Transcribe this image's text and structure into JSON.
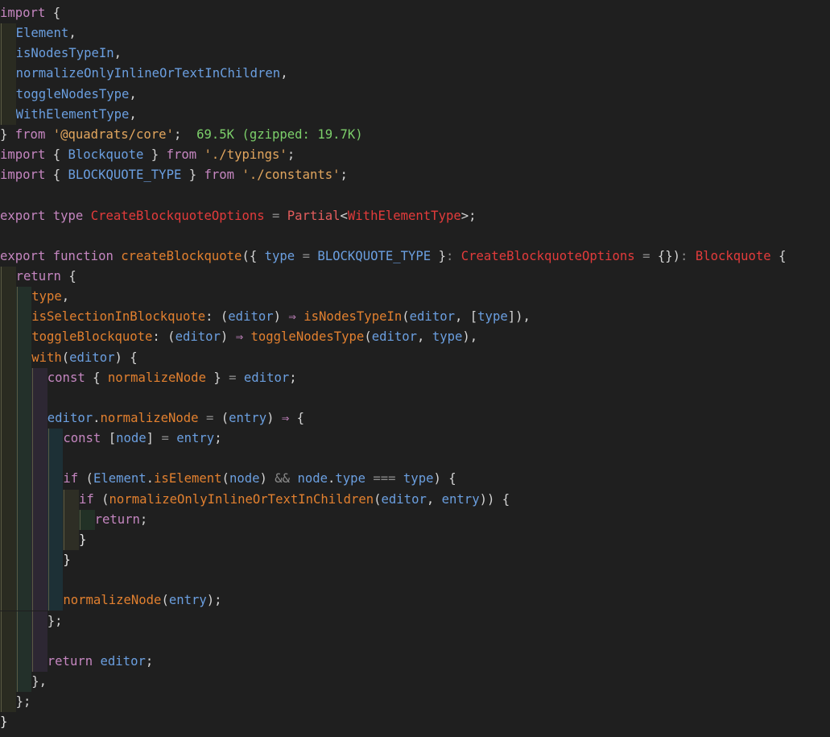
{
  "file": {
    "import_cost": "69.5K (gzipped: 19.7K)"
  },
  "code": {
    "import_kw": "import",
    "export_kw": "export",
    "from_kw": "from",
    "type_kw": "type",
    "function_kw": "function",
    "return_kw": "return",
    "with_kw": "with",
    "const_kw": "const",
    "if_kw": "if",
    "element": "Element",
    "isNodesTypeIn": "isNodesTypeIn",
    "normalizeOnlyInlineOrTextInChildren": "normalizeOnlyInlineOrTextInChildren",
    "toggleNodesType": "toggleNodesType",
    "withElementType": "WithElementType",
    "core_path": "'@quadrats/core'",
    "blockquote": "Blockquote",
    "typings_path": "'./typings'",
    "BLOCKQUOTE_TYPE": "BLOCKQUOTE_TYPE",
    "constants_path": "'./constants'",
    "createBlockquoteOptions": "CreateBlockquoteOptions",
    "partial": "Partial",
    "createBlockquote": "createBlockquote",
    "type_param": "type",
    "isSelectionInBlockquote": "isSelectionInBlockquote",
    "toggleBlockquote": "toggleBlockquote",
    "editor": "editor",
    "normalizeNode": "normalizeNode",
    "entry": "entry",
    "node": "node",
    "isElement": "isElement",
    "arrow": "⇒",
    "strict_eq": "===",
    "and_op": "&&"
  }
}
